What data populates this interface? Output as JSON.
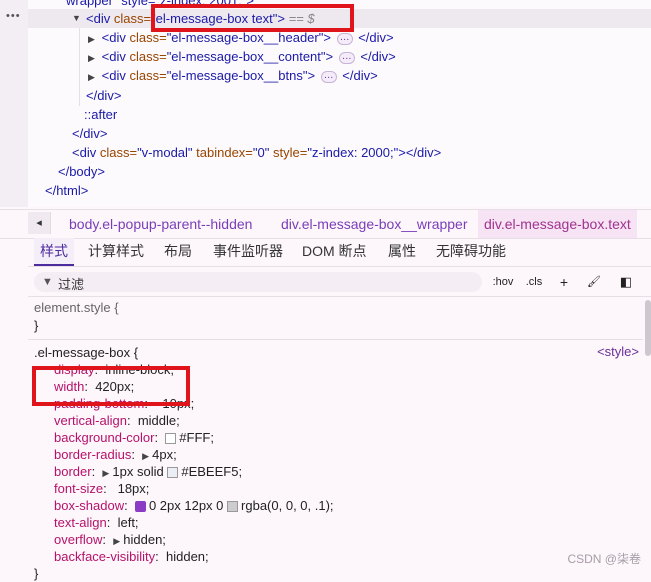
{
  "dom_tree": {
    "top_partial": "wrapper\" style=\"z-index: 2001;\">",
    "gutter_dots": "•••",
    "selected": {
      "tag_open": "<div",
      "attr": "class=",
      "value": "\"el-message-box text\"",
      "suffix": ">",
      "eq": "== $"
    },
    "children": [
      {
        "tag_open": "<div",
        "attr": "class=",
        "value": "\"el-message-box__header\"",
        "tag_close": "</div>",
        "pill": "…"
      },
      {
        "tag_open": "<div",
        "attr": "class=",
        "value": "\"el-message-box__content\"",
        "tag_close": "</div>",
        "pill": "…"
      },
      {
        "tag_open": "<div",
        "attr": "class=",
        "value": "\"el-message-box__btns\"",
        "tag_close": "</div>",
        "pill": "…"
      }
    ],
    "close_div": "</div>",
    "after": "::after",
    "close_div2": "</div>",
    "modal": {
      "tag_open": "<div",
      "attr1": "class=",
      "val1": "\"v-modal\"",
      "attr2": "tabindex=",
      "val2": "\"0\"",
      "attr3": "style=",
      "val3": "\"z-index: 2000;\"",
      "close": "></div>"
    },
    "close_body": "</body>",
    "close_html": "</html>"
  },
  "breadcrumbs": {
    "back": "◂",
    "items": [
      "body.el-popup-parent--hidden",
      "div.el-message-box__wrapper",
      "div.el-message-box.text"
    ]
  },
  "tabs": [
    "样式",
    "计算样式",
    "布局",
    "事件监听器",
    "DOM 断点",
    "属性",
    "无障碍功能"
  ],
  "filter": {
    "icon": "▼",
    "label": "过滤",
    "hov": ":hov",
    "cls": ".cls",
    "plus": "+",
    "paint": "🖌",
    "toggle": "◧"
  },
  "element_style": {
    "selector": "element.style {",
    "close": "}"
  },
  "rule": {
    "selector": ".el-message-box {",
    "source": "<style>",
    "declarations": [
      {
        "prop": "display",
        "val": "inline-block;"
      },
      {
        "prop": "width",
        "val": "420px;"
      },
      {
        "prop": "padding-bottom",
        "val": "10px;"
      },
      {
        "prop": "vertical-align",
        "val": "middle;"
      },
      {
        "prop": "background-color",
        "val": "#FFF;",
        "swatch": "#FFFFFF"
      },
      {
        "prop": "border-radius",
        "val": "4px;",
        "arrow": true
      },
      {
        "prop": "border",
        "val": "1px solid",
        "arrow": true,
        "swatch": "#EBEEF5",
        "val2": "#EBEEF5;"
      },
      {
        "prop": "font-size",
        "val": "18px;"
      },
      {
        "prop": "box-shadow",
        "val": "0 2px 12px 0",
        "shadowicon": true,
        "swatch": "#cccccc",
        "val2": "rgba(0, 0, 0, .1);"
      },
      {
        "prop": "text-align",
        "val": "left;"
      },
      {
        "prop": "overflow",
        "val": "hidden;",
        "arrow": true
      },
      {
        "prop": "backface-visibility",
        "val": "hidden;"
      }
    ],
    "close": "}"
  },
  "watermark": "CSDN @柒卷",
  "colors": {
    "highlight": "#e0151b",
    "accent": "#7a3db8"
  }
}
